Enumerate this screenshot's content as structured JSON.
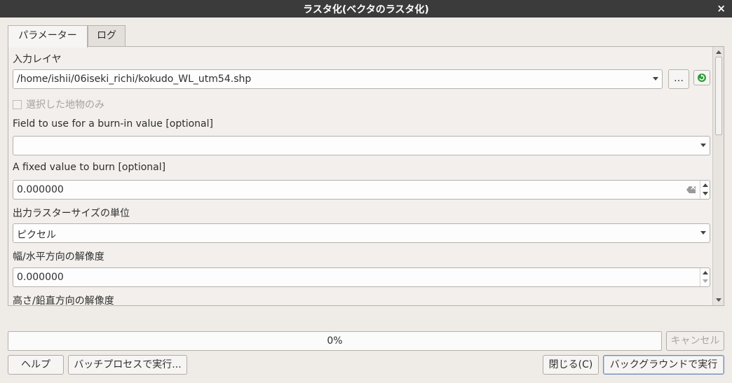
{
  "window": {
    "title": "ラスタ化(ベクタのラスタ化)",
    "close_glyph": "×"
  },
  "tabs": [
    {
      "label": "パラメーター",
      "active": true
    },
    {
      "label": "ログ",
      "active": false
    }
  ],
  "params": {
    "input_layer": {
      "label": "入力レイヤ",
      "value": "/home/ishii/06iseki_richi/kokudo_WL_utm54.shp",
      "browse_label": "…"
    },
    "selected_only": {
      "label": "選択した地物のみ",
      "checked": false,
      "enabled": false
    },
    "burn_field": {
      "label": "Field to use for a burn-in value [optional]",
      "value": ""
    },
    "fixed_value": {
      "label": "A fixed value to burn [optional]",
      "value": "0.000000"
    },
    "size_units": {
      "label": "出力ラスターサイズの単位",
      "value": "ピクセル"
    },
    "h_resolution": {
      "label": "幅/水平方向の解像度",
      "value": "0.000000"
    },
    "v_resolution": {
      "label": "高さ/鉛直方向の解像度"
    }
  },
  "progress": {
    "value": 0,
    "text": "0%"
  },
  "buttons": {
    "cancel": "キャンセル",
    "help": "ヘルプ",
    "batch": "バッチプロセスで実行...",
    "close": "閉じる(C)",
    "run": "バックグラウンドで実行"
  },
  "colors": {
    "titlebar": "#3b3b3b",
    "background": "#efebe7",
    "iterate_icon": "#2e9e3c"
  }
}
